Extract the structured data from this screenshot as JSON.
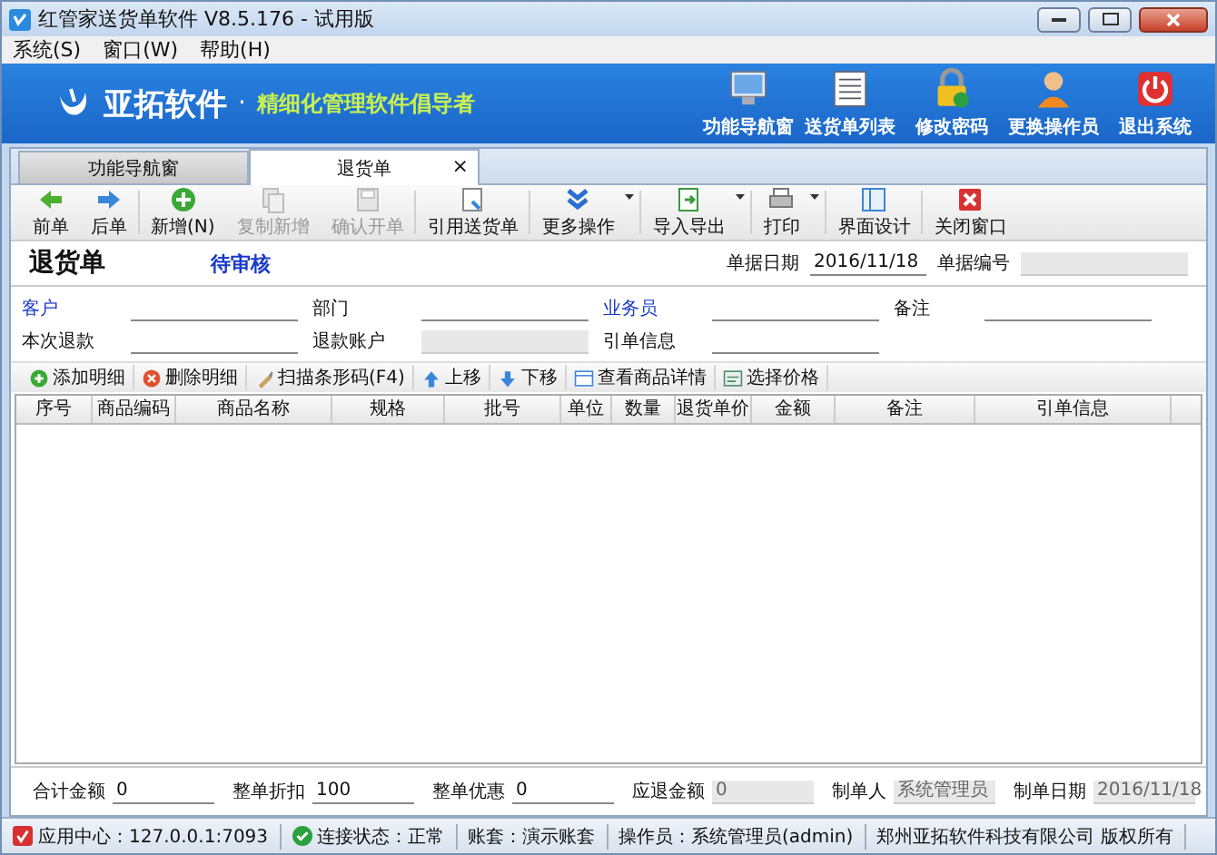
{
  "window": {
    "title": "红管家送货单软件 V8.5.176 - 试用版"
  },
  "menu": [
    "系统(S)",
    "窗口(W)",
    "帮助(H)"
  ],
  "banner": {
    "brand": "亚拓软件",
    "dot": "·",
    "slogan": "精细化管理软件倡导者",
    "buttons": [
      {
        "label": "功能导航窗"
      },
      {
        "label": "送货单列表"
      },
      {
        "label": "修改密码"
      },
      {
        "label": "更换操作员"
      },
      {
        "label": "退出系统"
      }
    ]
  },
  "tabs": [
    {
      "label": "功能导航窗",
      "selected": false
    },
    {
      "label": "退货单",
      "selected": true,
      "close": "×"
    }
  ],
  "toolbar": [
    {
      "label": "前单",
      "disabled": false,
      "dropdown": false
    },
    {
      "label": "后单",
      "disabled": false,
      "dropdown": false
    },
    {
      "label": "新增(N)",
      "disabled": false,
      "dropdown": false
    },
    {
      "label": "复制新增",
      "disabled": true,
      "dropdown": false
    },
    {
      "label": "确认开单",
      "disabled": true,
      "dropdown": false
    },
    {
      "label": "引用送货单",
      "disabled": false,
      "dropdown": false
    },
    {
      "label": "更多操作",
      "disabled": false,
      "dropdown": true
    },
    {
      "label": "导入导出",
      "disabled": false,
      "dropdown": true
    },
    {
      "label": "打印",
      "disabled": false,
      "dropdown": true
    },
    {
      "label": "界面设计",
      "disabled": false,
      "dropdown": false
    },
    {
      "label": "关闭窗口",
      "disabled": false,
      "dropdown": false
    }
  ],
  "document": {
    "title": "退货单",
    "status": "待审核",
    "fields": [
      {
        "label": "单据日期",
        "value": "2016/11/18",
        "disabled": false
      },
      {
        "label": "单据编号",
        "disabled": true
      }
    ]
  },
  "form": [
    {
      "label": "客户",
      "required": true,
      "disabled": false
    },
    {
      "label": "部门",
      "required": false,
      "disabled": false
    },
    {
      "label": "业务员",
      "required": true,
      "disabled": false
    },
    {
      "label": "备注",
      "required": false,
      "disabled": false
    },
    {
      "label": "本次退款",
      "required": false,
      "disabled": false
    },
    {
      "label": "退款账户",
      "required": false,
      "disabled": true
    },
    {
      "label": "引单信息",
      "required": false,
      "disabled": false
    }
  ],
  "detail_toolbar": [
    "添加明细",
    "删除明细",
    "扫描条形码(F4)",
    "上移",
    "下移",
    "查看商品详情",
    "选择价格"
  ],
  "table": {
    "columns": [
      "序号",
      "商品编码",
      "商品名称",
      "规格",
      "批号",
      "单位",
      "数量",
      "退货单价",
      "金额",
      "备注",
      "引单信息"
    ]
  },
  "totals": [
    {
      "label": "合计金额",
      "value": "0",
      "disabled": false
    },
    {
      "label": "整单折扣",
      "value": "100",
      "disabled": false
    },
    {
      "label": "整单优惠",
      "value": "0",
      "disabled": false
    },
    {
      "label": "应退金额",
      "value": "0",
      "disabled": true
    },
    {
      "label": "制单人",
      "value": "系统管理员",
      "disabled": true
    },
    {
      "label": "制单日期",
      "value": "2016/11/18",
      "disabled": true
    }
  ],
  "status_bar": [
    "应用中心：127.0.0.1:7093",
    "连接状态：正常",
    "账套：演示账套",
    "操作员：系统管理员(admin)",
    "郑州亚拓软件科技有限公司 版权所有"
  ]
}
